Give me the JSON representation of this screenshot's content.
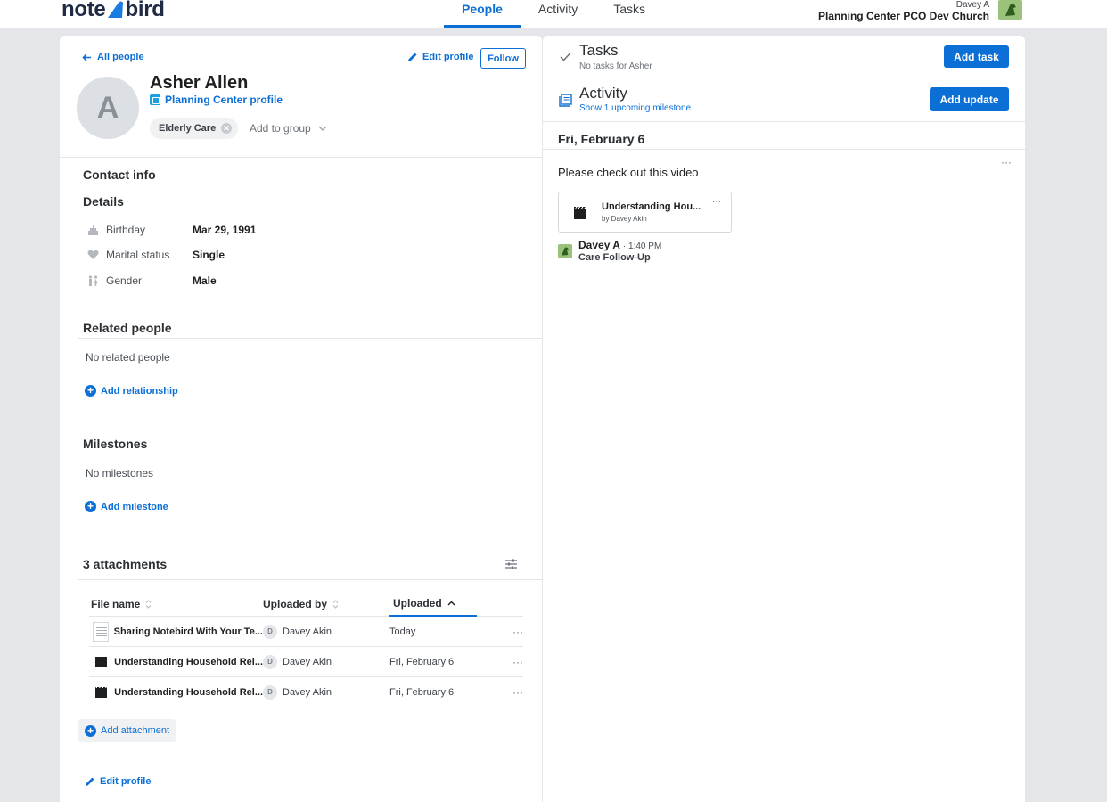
{
  "app": {
    "logo_left": "note",
    "logo_right": "bird",
    "nav": [
      {
        "label": "People",
        "active": true
      },
      {
        "label": "Activity",
        "active": false
      },
      {
        "label": "Tasks",
        "active": false
      }
    ],
    "user_name": "Davey A",
    "org_name": "Planning Center PCO Dev Church"
  },
  "profile": {
    "back_label": "All people",
    "edit_label": "Edit profile",
    "follow_label": "Follow",
    "avatar_initial": "A",
    "name": "Asher Allen",
    "pco_link": "Planning Center profile",
    "group_chip": "Elderly Care",
    "add_group_label": "Add to group"
  },
  "contact": {
    "title": "Contact info",
    "details_title": "Details",
    "rows": [
      {
        "icon": "cake-icon",
        "label": "Birthday",
        "value": "Mar 29, 1991"
      },
      {
        "icon": "heart-icon",
        "label": "Marital status",
        "value": "Single"
      },
      {
        "icon": "gender-icon",
        "label": "Gender",
        "value": "Male"
      }
    ]
  },
  "related": {
    "title": "Related people",
    "empty": "No related people",
    "add_label": "Add relationship"
  },
  "milestones": {
    "title": "Milestones",
    "empty": "No milestones",
    "add_label": "Add milestone"
  },
  "attachments": {
    "title": "3 attachments",
    "columns": {
      "file": "File name",
      "by": "Uploaded by",
      "date": "Uploaded"
    },
    "rows": [
      {
        "type": "doc",
        "file": "Sharing Notebird With Your Te...",
        "by_initial": "D",
        "by": "Davey Akin",
        "date": "Today"
      },
      {
        "type": "video",
        "file": "Understanding Household Rel...",
        "by_initial": "D",
        "by": "Davey Akin",
        "date": "Fri, February 6"
      },
      {
        "type": "video",
        "file": "Understanding Household Rel...",
        "by_initial": "D",
        "by": "Davey Akin",
        "date": "Fri, February 6"
      }
    ],
    "add_label": "Add attachment",
    "more_label": "···"
  },
  "footer": {
    "edit_label": "Edit profile"
  },
  "tasks": {
    "title": "Tasks",
    "subtitle": "No tasks for Asher",
    "add_label": "Add task"
  },
  "activity": {
    "title": "Activity",
    "subtitle": "Show 1 upcoming milestone",
    "add_label": "Add update",
    "date_header": "Fri, February 6",
    "note_text": "Please check out this video",
    "card_title": "Understanding Hou...",
    "card_by": "by Davey Akin",
    "author": "Davey A",
    "time": "· 1:40 PM",
    "category": "Care Follow-Up",
    "more_label": "···"
  },
  "colors": {
    "accent": "#0b6fd6",
    "background": "#e4e6ea",
    "avatar_green": "#9ac27a"
  }
}
